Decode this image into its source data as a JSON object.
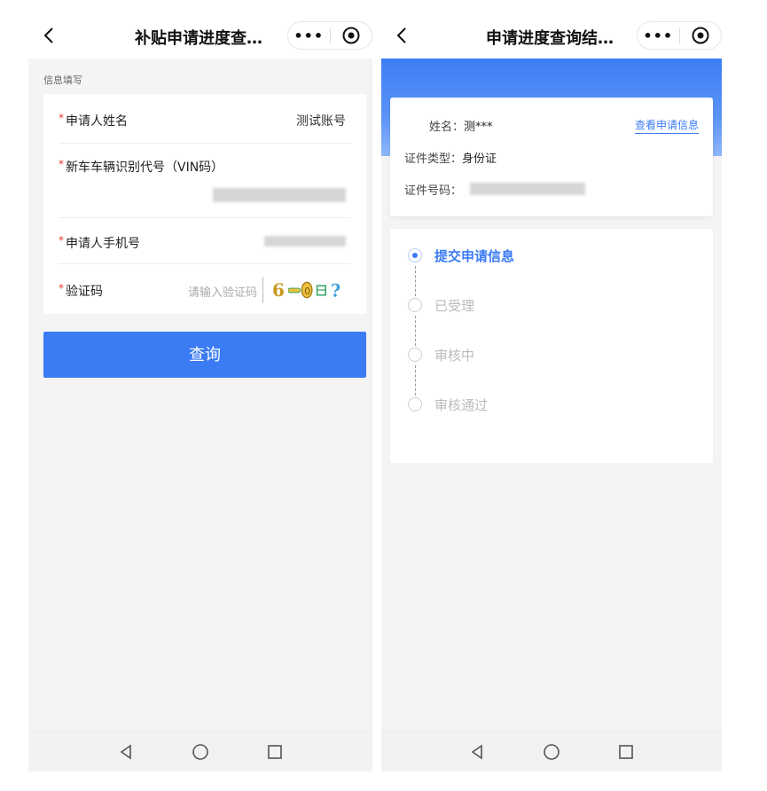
{
  "left": {
    "title": "补贴申请进度查…",
    "capsule_more": "•••",
    "section_label": "信息填写",
    "fields": [
      {
        "required_mark": "*",
        "label": "申请人姓名",
        "value": "测试账号"
      },
      {
        "required_mark": "*",
        "label": "新车车辆识别代号（VIN码）"
      },
      {
        "required_mark": "*",
        "label": "申请人手机号"
      },
      {
        "required_mark": "*",
        "label": "验证码",
        "placeholder": "请输入验证码",
        "captcha_text": "6"
      }
    ],
    "query_button": "查询"
  },
  "right": {
    "title": "申请进度查询结…",
    "capsule_more": "•••",
    "name_label": "姓名：",
    "name_value": "测***",
    "view_link": "查看申请信息",
    "id_type_label": "证件类型：",
    "id_type_value": "身份证",
    "id_number_label": "证件号码：",
    "steps": [
      {
        "label": "提交申请信息",
        "active": true
      },
      {
        "label": "已受理",
        "active": false
      },
      {
        "label": "审核中",
        "active": false
      },
      {
        "label": "审核通过",
        "active": false
      }
    ]
  },
  "colors": {
    "accent": "#3b7cf4",
    "required": "#e53935",
    "background": "#f4f4f4"
  }
}
